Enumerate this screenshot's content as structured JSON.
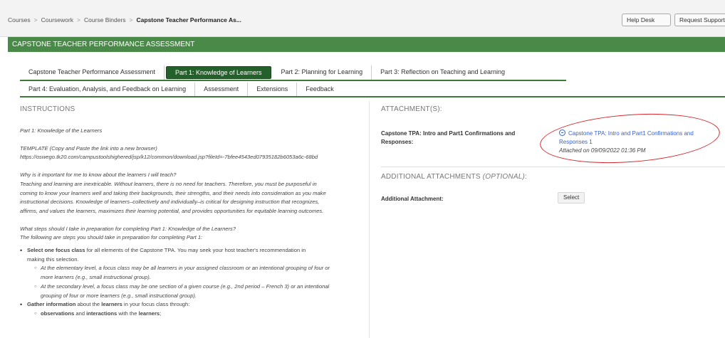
{
  "breadcrumb": {
    "items": [
      "Courses",
      "Coursework",
      "Course Binders"
    ],
    "separator": ">",
    "current": "Capstone Teacher Performance As..."
  },
  "header_buttons": {
    "help": "Help Desk",
    "request": "Request Support"
  },
  "page_title": "CAPSTONE TEACHER PERFORMANCE ASSESSMENT",
  "tabs": {
    "row1": [
      "Capstone Teacher Performance Assessment",
      "Part 1: Knowledge of Learners",
      "Part 2: Planning for Learning",
      "Part 3: Reflection on Teaching and Learning"
    ],
    "row2": [
      "Part 4: Evaluation, Analysis, and Feedback on Learning",
      "Assessment",
      "Extensions",
      "Feedback"
    ],
    "active": "Part 1: Knowledge of Learners"
  },
  "instructions": {
    "heading": "INSTRUCTIONS",
    "part_title": "Part 1: Knowledge of the Learners",
    "template_label": "TEMPLATE (Copy and Paste the link into a new browser)",
    "template_url": "https://oswego.tk20.com/campustoolshighered/jsp/k12/common/download.jsp?fileId=-7bfee4543ed07935182b6053a6c-68bd",
    "why_q": "Why is it important for me to know about the learners I will teach?",
    "why_lines": [
      "Teaching and learning are inextricable. Without learners, there is no need for teachers. Therefore, you must be purposeful in",
      "coming to know your learners well and taking their backgrounds, their strengths, and their needs into consideration as you make",
      "instructional decisions. Knowledge of learners–collectively and individually–is critical for designing instruction that recognizes,",
      "affirms, and values the learners, maximizes their learning potential, and provides opportunities for equitable learning outcomes."
    ],
    "steps_q": "What steps should I take in preparation for completing Part 1: Knowledge of the Learners?",
    "steps_intro": "The following are steps you should take in preparation for completing Part 1:",
    "b1_strong": "Select one focus class",
    "b1_rest": " for all elements of the Capstone TPA. You may seek your host teacher's recommendation in",
    "b1_line2": "making this selection.",
    "b1_subs": [
      "At the elementary level, a focus class may be all learners in your assigned classroom or an intentional grouping of four or",
      "more learners (e.g., small instructional group).",
      "At the secondary level, a focus class may be one section of a given course (e.g., 2nd period – French 3) or an intentional",
      "grouping of four or more learners (e.g., small instructional group)."
    ],
    "b2_strong1": "Gather information",
    "b2_mid": " about the ",
    "b2_strong2": "learners",
    "b2_rest": " in your focus class through:",
    "b2_sub_strong1": "observations",
    "b2_sub_mid": " and ",
    "b2_sub_strong2": "interactions",
    "b2_sub_mid2": " with the ",
    "b2_sub_strong3": "learners",
    "b2_sub_end": ";"
  },
  "attachments": {
    "heading": "ATTACHMENT(S):",
    "label": "Capstone TPA: Intro and Part1 Confirmations and Responses:",
    "link": "Capstone TPA: Intro and Part1 Confirmations and Responses 1",
    "date": "Attached on 09/09/2022 01:36 PM",
    "additional_heading": "ADDITIONAL ATTACHMENTS",
    "optional": "(OPTIONAL)",
    "colon": ":",
    "additional_label": "Additional Attachment:",
    "select": "Select"
  }
}
